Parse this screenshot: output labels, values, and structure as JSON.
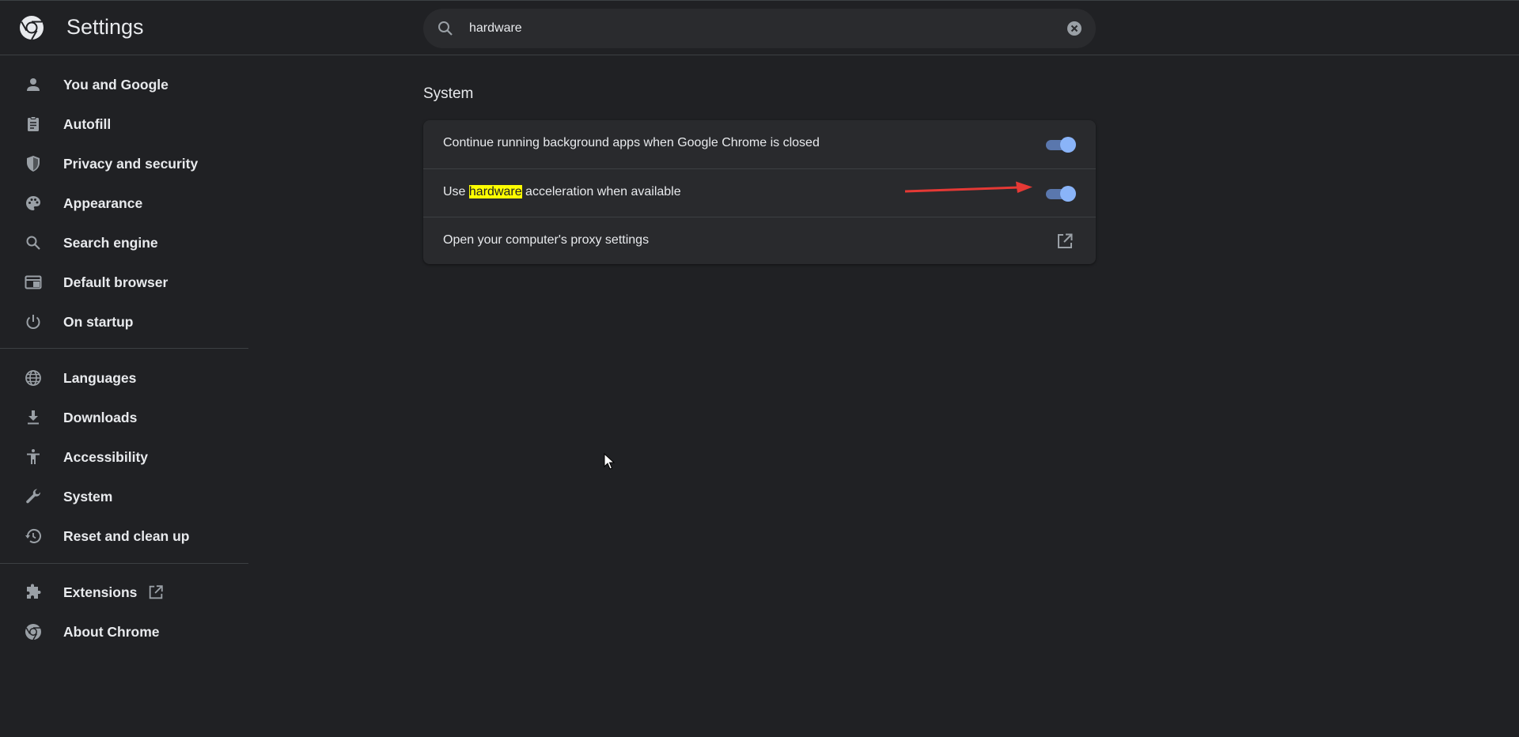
{
  "header": {
    "title": "Settings",
    "logo_icon": "chrome-logo-icon",
    "search": {
      "value": "hardware",
      "placeholder": "Search settings",
      "search_icon": "search-icon",
      "clear_icon": "clear-icon"
    }
  },
  "sidebar": {
    "items": [
      {
        "label": "You and Google",
        "icon": "person-icon"
      },
      {
        "label": "Autofill",
        "icon": "clipboard-icon"
      },
      {
        "label": "Privacy and security",
        "icon": "shield-icon"
      },
      {
        "label": "Appearance",
        "icon": "palette-icon"
      },
      {
        "label": "Search engine",
        "icon": "search-icon"
      },
      {
        "label": "Default browser",
        "icon": "browser-window-icon"
      },
      {
        "label": "On startup",
        "icon": "power-icon"
      },
      {
        "label": "Languages",
        "icon": "globe-icon"
      },
      {
        "label": "Downloads",
        "icon": "download-icon"
      },
      {
        "label": "Accessibility",
        "icon": "accessibility-icon"
      },
      {
        "label": "System",
        "icon": "wrench-icon"
      },
      {
        "label": "Reset and clean up",
        "icon": "history-icon"
      },
      {
        "label": "Extensions",
        "icon": "puzzle-icon"
      },
      {
        "label": "About Chrome",
        "icon": "chrome-logo-icon"
      }
    ]
  },
  "main": {
    "section_title": "System",
    "rows": [
      {
        "label": "Continue running background apps when Google Chrome is closed",
        "control": "toggle",
        "checked": true
      },
      {
        "label_before": "Use ",
        "label_highlight": "hardware",
        "label_after": " acceleration when available",
        "control": "toggle",
        "checked": true
      },
      {
        "label": "Open your computer's proxy settings",
        "control": "open-in-new-icon"
      }
    ]
  },
  "colors": {
    "background": "#202124",
    "card": "#292a2d",
    "toggle_on": "#8ab4f8",
    "highlight": "#ffff00",
    "annotation_arrow": "#e53935"
  }
}
